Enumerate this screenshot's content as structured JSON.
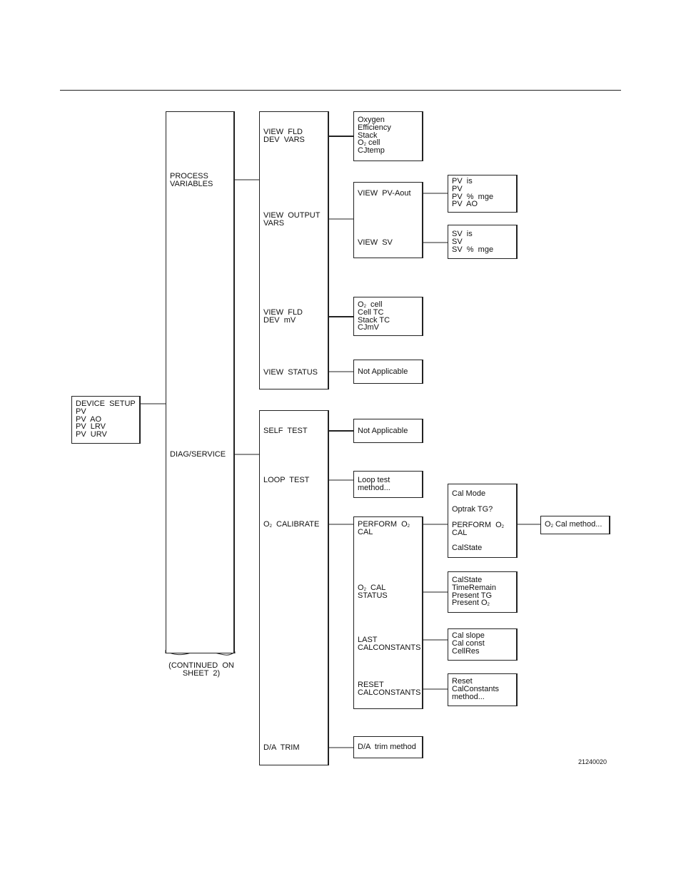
{
  "device_setup": {
    "lines": [
      [
        {
          "t": "DEVICE  SETUP"
        }
      ],
      [
        {
          "t": "PV"
        }
      ],
      [
        {
          "t": "PV  AO"
        }
      ],
      [
        {
          "t": "PV  LRV"
        }
      ],
      [
        {
          "t": "PV  URV"
        }
      ]
    ]
  },
  "menu_main": {
    "items": [
      [
        [
          {
            "t": "PROCESS"
          }
        ],
        [
          {
            "t": "VARIABLES"
          }
        ]
      ],
      [
        [
          {
            "t": "DIAG/SERVICE"
          }
        ]
      ]
    ],
    "continued_note": "(CONTINUED  ON\nSHEET  2)"
  },
  "process_variables": {
    "items": [
      [
        [
          {
            "t": "VIEW  FLD"
          }
        ],
        [
          {
            "t": "DEV  VARS"
          }
        ]
      ],
      [
        [
          {
            "t": "VIEW  OUTPUT"
          }
        ],
        [
          {
            "t": "VARS"
          }
        ]
      ],
      [
        [
          {
            "t": "VIEW  FLD"
          }
        ],
        [
          {
            "t": "DEV  mV"
          }
        ]
      ],
      [
        [
          {
            "t": "VIEW  STATUS"
          }
        ]
      ]
    ]
  },
  "diag_service": {
    "items": [
      [
        [
          {
            "t": "SELF  TEST"
          }
        ]
      ],
      [
        [
          {
            "t": "LOOP  TEST"
          }
        ]
      ],
      [
        [
          {
            "t": "O"
          },
          {
            "t": "2",
            "sub": true
          },
          {
            "t": "  CALIBRATE"
          }
        ]
      ],
      [
        [
          {
            "t": "D/A  TRIM"
          }
        ]
      ]
    ]
  },
  "fld_dev_vars": {
    "lines": [
      [
        {
          "t": "Oxygen"
        }
      ],
      [
        {
          "t": "Efficiency"
        }
      ],
      [
        {
          "t": "Stack"
        }
      ],
      [
        {
          "t": "O"
        },
        {
          "t": "2",
          "sub": true
        },
        {
          "t": " cell"
        }
      ],
      [
        {
          "t": "CJtemp"
        }
      ]
    ]
  },
  "output_vars": {
    "items": [
      [
        [
          {
            "t": "VIEW  PV-Aout"
          }
        ]
      ],
      [
        [
          {
            "t": "VIEW  SV"
          }
        ]
      ]
    ]
  },
  "pv_aout": {
    "lines": [
      [
        {
          "t": "PV  is"
        }
      ],
      [
        {
          "t": "PV"
        }
      ],
      [
        {
          "t": "PV  %  mge"
        }
      ],
      [
        {
          "t": "PV  AO"
        }
      ]
    ]
  },
  "view_sv": {
    "lines": [
      [
        {
          "t": "SV  is"
        }
      ],
      [
        {
          "t": "SV"
        }
      ],
      [
        {
          "t": "SV  %  mge"
        }
      ]
    ]
  },
  "fld_dev_mv": {
    "lines": [
      [
        {
          "t": "O"
        },
        {
          "t": "2",
          "sub": true
        },
        {
          "t": "  cell"
        }
      ],
      [
        {
          "t": "Cell TC"
        }
      ],
      [
        {
          "t": "Stack TC"
        }
      ],
      [
        {
          "t": "CJmV"
        }
      ]
    ]
  },
  "view_status": {
    "lines": [
      [
        {
          "t": "Not Applicable"
        }
      ]
    ]
  },
  "self_test": {
    "lines": [
      [
        {
          "t": "Not Applicable"
        }
      ]
    ]
  },
  "loop_test": {
    "lines": [
      [
        {
          "t": "Loop test"
        }
      ],
      [
        {
          "t": "method..."
        }
      ]
    ]
  },
  "o2_calibrate": {
    "items": [
      [
        [
          {
            "t": "PERFORM  O"
          },
          {
            "t": "2",
            "sub": true
          }
        ],
        [
          {
            "t": "CAL"
          }
        ]
      ],
      [
        [
          {
            "t": "O"
          },
          {
            "t": "2",
            "sub": true
          },
          {
            "t": "  CAL"
          }
        ],
        [
          {
            "t": "STATUS"
          }
        ]
      ],
      [
        [
          {
            "t": "LAST"
          }
        ],
        [
          {
            "t": "CALCONSTANTS"
          }
        ]
      ],
      [
        [
          {
            "t": "RESET"
          }
        ],
        [
          {
            "t": "CALCONSTANTS"
          }
        ]
      ]
    ]
  },
  "perform_cal": {
    "items": [
      [
        [
          {
            "t": "Cal Mode"
          }
        ]
      ],
      [
        [
          {
            "t": "Optrak TG?"
          }
        ]
      ],
      [
        [
          {
            "t": "PERFORM  O"
          },
          {
            "t": "2",
            "sub": true
          }
        ],
        [
          {
            "t": "CAL"
          }
        ]
      ],
      [
        [
          {
            "t": "CalState"
          }
        ]
      ]
    ]
  },
  "o2_cal_method": {
    "lines": [
      [
        {
          "t": "O"
        },
        {
          "t": "2",
          "sub": true
        },
        {
          "t": " Cal method..."
        }
      ]
    ]
  },
  "cal_status": {
    "lines": [
      [
        {
          "t": "CalState"
        }
      ],
      [
        {
          "t": "TimeRemain"
        }
      ],
      [
        {
          "t": "Present TG"
        }
      ],
      [
        {
          "t": "Present O"
        },
        {
          "t": "2",
          "sub": true
        }
      ]
    ]
  },
  "last_cal": {
    "lines": [
      [
        {
          "t": "Cal slope"
        }
      ],
      [
        {
          "t": "Cal const"
        }
      ],
      [
        {
          "t": "CellRes"
        }
      ]
    ]
  },
  "reset_cal": {
    "lines": [
      [
        {
          "t": "Reset"
        }
      ],
      [
        {
          "t": "CalConstants"
        }
      ],
      [
        {
          "t": "method..."
        }
      ]
    ]
  },
  "da_trim": {
    "lines": [
      [
        {
          "t": "D/A  trim method"
        }
      ]
    ]
  },
  "figure_number": "21240020"
}
